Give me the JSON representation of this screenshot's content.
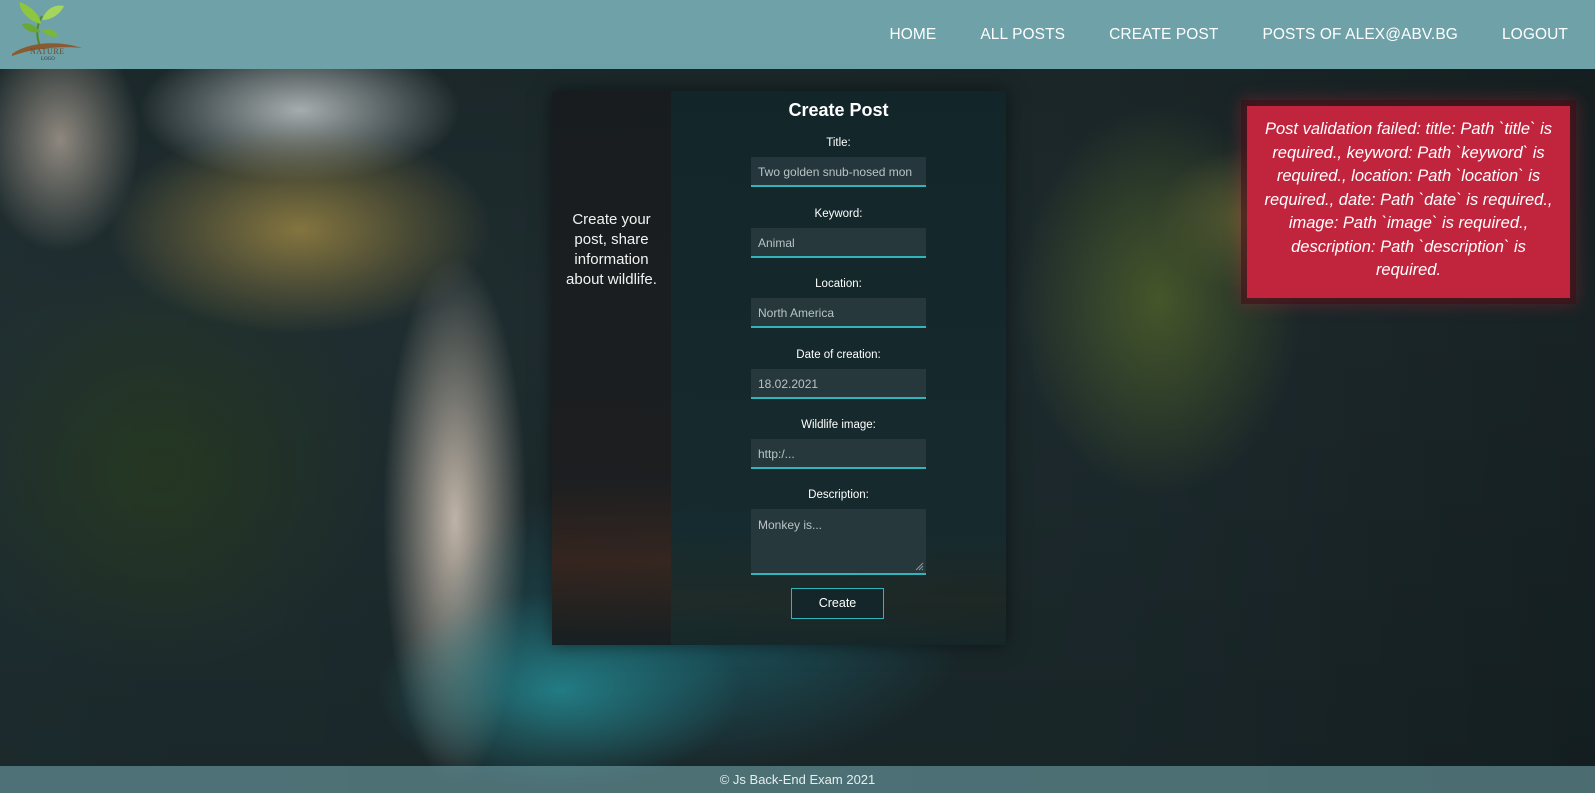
{
  "header": {
    "logo": {
      "word": "NATURE",
      "sub": "LOGO"
    },
    "nav": [
      {
        "label": "HOME"
      },
      {
        "label": "ALL POSTS"
      },
      {
        "label": "CREATE POST"
      },
      {
        "label": "POSTS OF ALEX@ABV.BG"
      },
      {
        "label": "LOGOUT"
      }
    ]
  },
  "form": {
    "side_text": "Create your post, share information about wildlife.",
    "title": "Create Post",
    "fields": {
      "title": {
        "label": "Title:",
        "value": "Two golden snub-nosed mon"
      },
      "keyword": {
        "label": "Keyword:",
        "value": "Animal"
      },
      "location": {
        "label": "Location:",
        "value": "North America"
      },
      "date": {
        "label": "Date of creation:",
        "value": "18.02.2021"
      },
      "image": {
        "label": "Wildlife image:",
        "placeholder": "http:/..."
      },
      "description": {
        "label": "Description:",
        "placeholder": "Monkey is..."
      }
    },
    "submit_label": "Create"
  },
  "error": {
    "message": "Post validation failed: title: Path `title` is required., keyword: Path `keyword` is required., location: Path `location` is required., date: Path `date` is required., image: Path `image` is required., description: Path `description` is required."
  },
  "footer": {
    "text": "© Js Back-End Exam 2021"
  },
  "colors": {
    "header": "#6fa1a8",
    "accent": "#2fb5ba",
    "error": "#c0253d"
  }
}
